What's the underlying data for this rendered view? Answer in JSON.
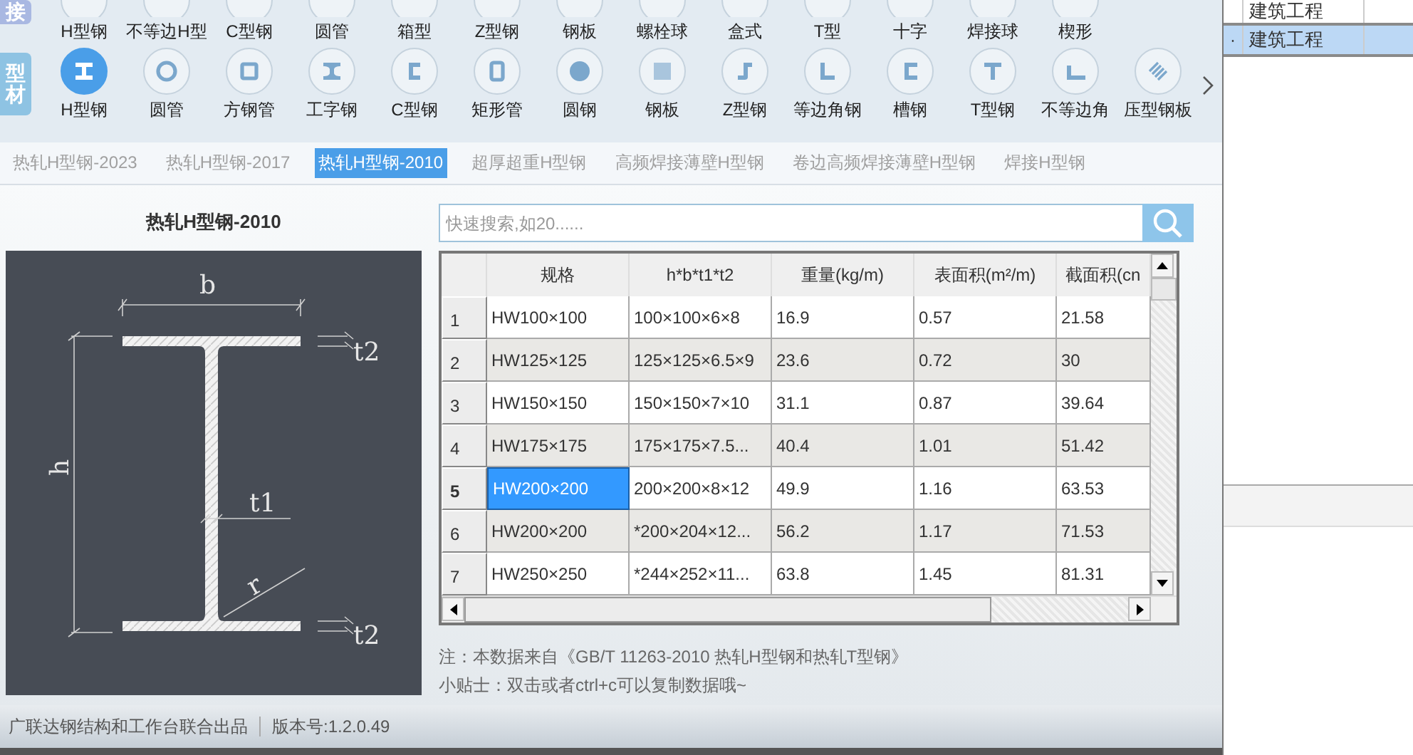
{
  "category_tabs": [
    {
      "label": "接",
      "color": "#a9b8e2"
    },
    {
      "label": "型材",
      "color": "#8ec3e3"
    }
  ],
  "shape_rows": [
    [
      {
        "label": "H型钢",
        "selected": false
      },
      {
        "label": "不等边H型",
        "selected": false
      },
      {
        "label": "C型钢",
        "selected": false
      },
      {
        "label": "圆管",
        "selected": false
      },
      {
        "label": "箱型",
        "selected": false
      },
      {
        "label": "Z型钢",
        "selected": false
      },
      {
        "label": "钢板",
        "selected": false
      },
      {
        "label": "螺栓球",
        "selected": false
      },
      {
        "label": "盒式",
        "selected": false
      },
      {
        "label": "T型",
        "selected": false
      },
      {
        "label": "十字",
        "selected": false
      },
      {
        "label": "焊接球",
        "selected": false
      },
      {
        "label": "楔形",
        "selected": false
      }
    ],
    [
      {
        "label": "H型钢",
        "selected": true
      },
      {
        "label": "圆管",
        "selected": false
      },
      {
        "label": "方钢管",
        "selected": false
      },
      {
        "label": "工字钢",
        "selected": false
      },
      {
        "label": "C型钢",
        "selected": false
      },
      {
        "label": "矩形管",
        "selected": false
      },
      {
        "label": "圆钢",
        "selected": false
      },
      {
        "label": "钢板",
        "selected": false
      },
      {
        "label": "Z型钢",
        "selected": false
      },
      {
        "label": "等边角钢",
        "selected": false
      },
      {
        "label": "槽钢",
        "selected": false
      },
      {
        "label": "T型钢",
        "selected": false
      },
      {
        "label": "不等边角",
        "selected": false
      },
      {
        "label": "压型钢板",
        "selected": false
      }
    ]
  ],
  "subtabs": [
    {
      "label": "热轧H型钢-2023",
      "selected": false
    },
    {
      "label": "热轧H型钢-2017",
      "selected": false
    },
    {
      "label": "热轧H型钢-2010",
      "selected": true
    },
    {
      "label": "超厚超重H型钢",
      "selected": false
    },
    {
      "label": "高频焊接薄壁H型钢",
      "selected": false
    },
    {
      "label": "卷边高频焊接薄壁H型钢",
      "selected": false
    },
    {
      "label": "焊接H型钢",
      "selected": false
    }
  ],
  "section_drawing": {
    "title": "热轧H型钢-2010",
    "labels": {
      "b": "b",
      "h": "h",
      "t1": "t1",
      "t2_top": "t2",
      "t2_bottom": "t2",
      "r": "r"
    }
  },
  "search": {
    "placeholder": "快速搜索,如20......"
  },
  "table": {
    "columns": [
      "规格",
      "h*b*t1*t2",
      "重量(kg/m)",
      "表面积(m²/m)",
      "截面积(cn"
    ],
    "rows": [
      {
        "number": "1",
        "selected": false,
        "cells": [
          "HW100×100",
          "100×100×6×8",
          "16.9",
          "0.57",
          "21.58"
        ]
      },
      {
        "number": "2",
        "selected": false,
        "cells": [
          "HW125×125",
          "125×125×6.5×9",
          "23.6",
          "0.72",
          "30"
        ]
      },
      {
        "number": "3",
        "selected": false,
        "cells": [
          "HW150×150",
          "150×150×7×10",
          "31.1",
          "0.87",
          "39.64"
        ]
      },
      {
        "number": "4",
        "selected": false,
        "cells": [
          "HW175×175",
          "175×175×7.5...",
          "40.4",
          "1.01",
          "51.42"
        ]
      },
      {
        "number": "5",
        "selected": true,
        "cells": [
          "HW200×200",
          "200×200×8×12",
          "49.9",
          "1.16",
          "63.53"
        ]
      },
      {
        "number": "6",
        "selected": false,
        "cells": [
          "HW200×200",
          "*200×204×12...",
          "56.2",
          "1.17",
          "71.53"
        ]
      },
      {
        "number": "7",
        "selected": false,
        "cells": [
          "HW250×250",
          "*244×252×11...",
          "63.8",
          "1.45",
          "81.31"
        ]
      }
    ]
  },
  "notes": [
    "注：本数据来自《GB/T 11263-2010 热轧H型钢和热轧T型钢》",
    "小贴士：双击或者ctrl+c可以复制数据哦~"
  ],
  "status_bar": {
    "credit": "广联达钢结构和工作台联合出品",
    "version": "版本号:1.2.0.49"
  },
  "side_panel": {
    "rows": [
      {
        "name": "建筑工程",
        "selected": false
      },
      {
        "marker": "·",
        "name": "建筑工程",
        "selected": true
      }
    ]
  }
}
